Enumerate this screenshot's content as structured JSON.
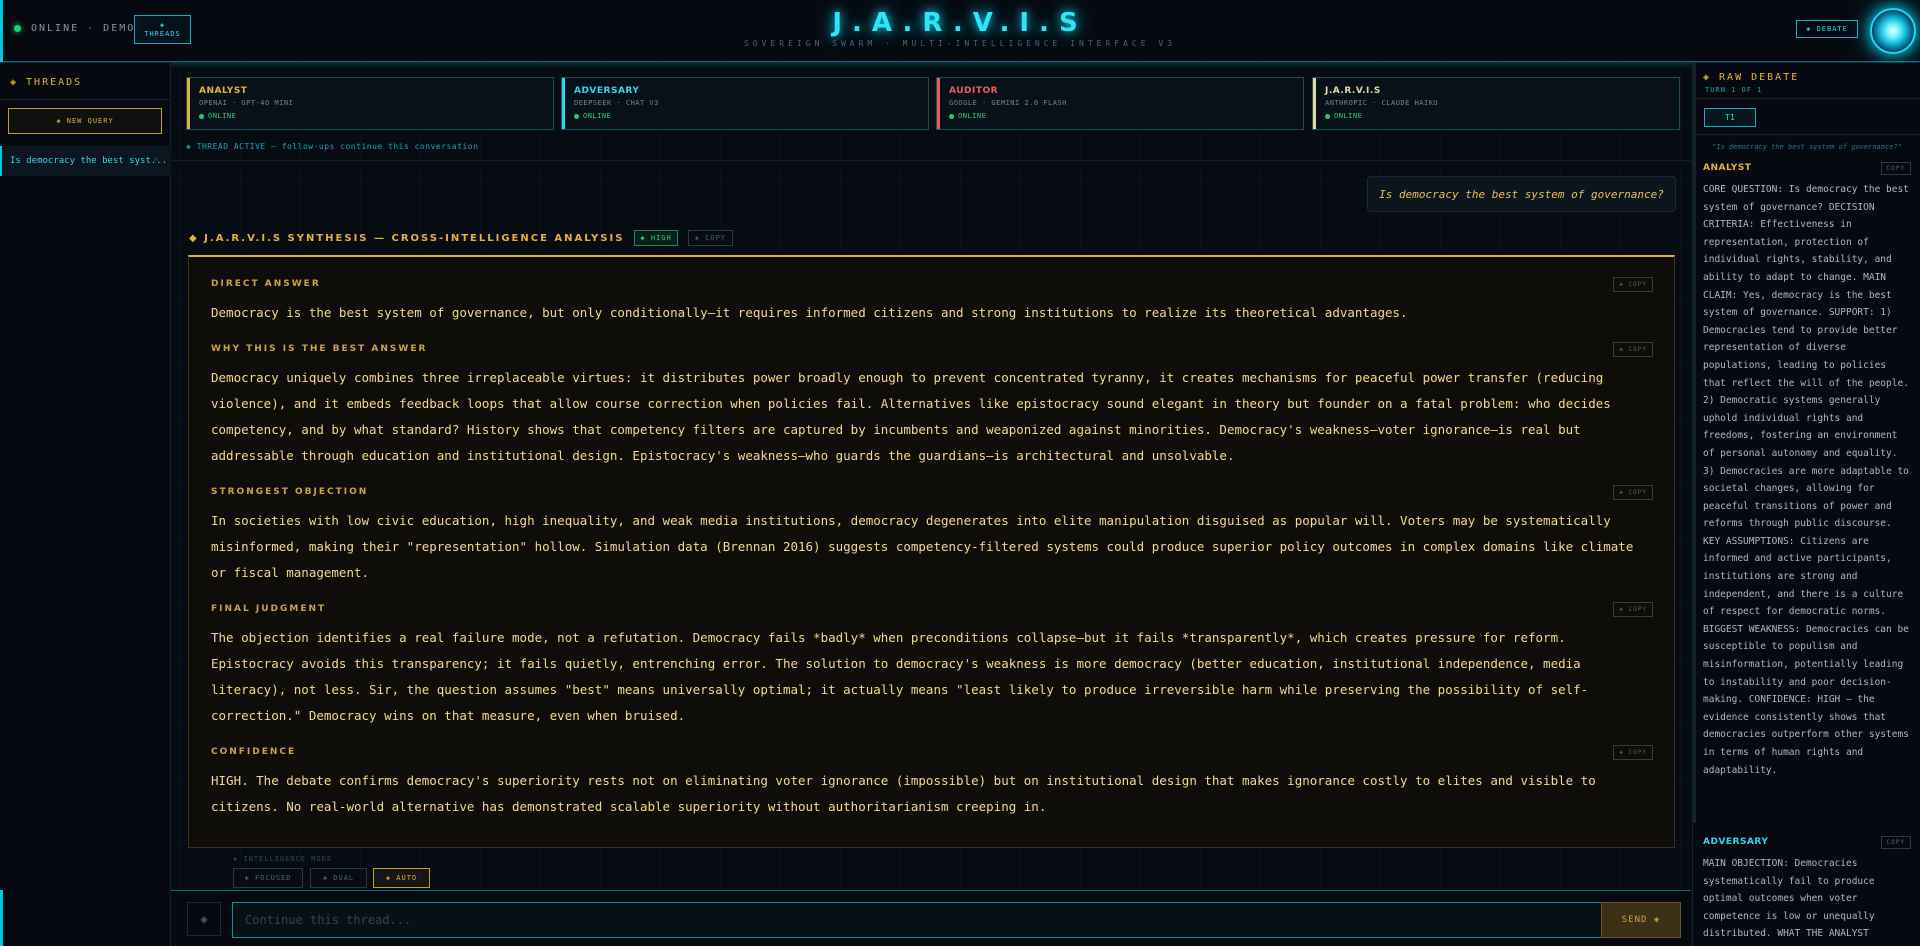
{
  "header": {
    "status_text": "ONLINE · DEMO",
    "threads_icon": "◈",
    "threads_label": "THREADS",
    "title": "J.A.R.V.I.S",
    "subtitle": "SOVEREIGN SWARM · MULTI-INTELLIGENCE INTERFACE V3",
    "debate_label": "◈ DEBATE"
  },
  "sidebar": {
    "title": "◈ THREADS",
    "new_query_label": "◈ NEW QUERY",
    "threads": [
      {
        "label": "Is democracy the best syst...",
        "close": "×"
      }
    ]
  },
  "agents": [
    {
      "name": "ANALYST",
      "model": "OPENAI · GPT-4O MINI",
      "status": "ONLINE",
      "color": "#e2b23a"
    },
    {
      "name": "ADVERSARY",
      "model": "DEEPSEEK · CHAT V3",
      "status": "ONLINE",
      "color": "#2fd6ec"
    },
    {
      "name": "AUDITOR",
      "model": "GOOGLE · GEMINI 2.0 FLASH",
      "status": "ONLINE",
      "color": "#ee5a5a"
    },
    {
      "name": "J.A.R.V.I.S",
      "model": "ANTHROPIC · CLAUDE HAIKU",
      "status": "ONLINE",
      "color": "#e8d7a0"
    }
  ],
  "thread_active": "◈ THREAD ACTIVE — follow-ups continue this conversation",
  "query": "Is democracy the best system of governance?",
  "synthesis": {
    "title": "◆ J.A.R.V.I.S SYNTHESIS — CROSS-INTELLIGENCE ANALYSIS",
    "confidence_badge": "◆ HIGH",
    "copy_label": "◈ COPY",
    "sections": [
      {
        "label": "DIRECT ANSWER",
        "copy": "◈ COPY",
        "text": "Democracy is the best system of governance, but only conditionally—it requires informed citizens and strong institutions to realize its theoretical advantages."
      },
      {
        "label": "WHY THIS IS THE BEST ANSWER",
        "copy": "◈ COPY",
        "text": "Democracy uniquely combines three irreplaceable virtues: it distributes power broadly enough to prevent concentrated tyranny, it creates mechanisms for peaceful power transfer (reducing violence), and it embeds feedback loops that allow course correction when policies fail. Alternatives like epistocracy sound elegant in theory but founder on a fatal problem: who decides competency, and by what standard? History shows that competency filters are captured by incumbents and weaponized against minorities. Democracy's weakness—voter ignorance—is real but addressable through education and institutional design. Epistocracy's weakness—who guards the guardians—is architectural and unsolvable."
      },
      {
        "label": "STRONGEST OBJECTION",
        "copy": "◈ COPY",
        "text": "In societies with low civic education, high inequality, and weak media institutions, democracy degenerates into elite manipulation disguised as popular will. Voters may be systematically misinformed, making their \"representation\" hollow. Simulation data (Brennan 2016) suggests competency-filtered systems could produce superior policy outcomes in complex domains like climate or fiscal management."
      },
      {
        "label": "FINAL JUDGMENT",
        "copy": "◈ COPY",
        "text": "The objection identifies a real failure mode, not a refutation. Democracy fails *badly* when preconditions collapse—but it fails *transparently*, which creates pressure for reform. Epistocracy avoids this transparency; it fails quietly, entrenching error. The solution to democracy's weakness is more democracy (better education, institutional independence, media literacy), not less. Sir, the question assumes \"best\" means universally optimal; it actually means \"least likely to produce irreversible harm while preserving the possibility of self-correction.\" Democracy wins on that measure, even when bruised."
      },
      {
        "label": "CONFIDENCE",
        "copy": "◈ COPY",
        "text": "HIGH. The debate confirms democracy's superiority rests not on eliminating voter ignorance (impossible) but on institutional design that makes ignorance costly to elites and visible to citizens. No real-world alternative has demonstrated scalable superiority without authoritarianism creeping in."
      }
    ]
  },
  "modes": {
    "label": "◈ INTELLIGENCE MODE",
    "options": [
      {
        "label": "◈ FOCUSED",
        "active": false
      },
      {
        "label": "◈ DUAL",
        "active": false
      },
      {
        "label": "◈ AUTO",
        "active": true
      }
    ]
  },
  "input": {
    "attach_icon": "◈",
    "placeholder": "Continue this thread...",
    "value": "",
    "send_label": "SEND ◈"
  },
  "debate_panel": {
    "title": "◈ RAW DEBATE",
    "turn": "TURN 1 OF 1",
    "tab": "T1",
    "question": "\"Is democracy the best system of governance?\"",
    "entries": [
      {
        "agent": "ANALYST",
        "color": "#e2b23a",
        "copy": "COPY",
        "text": "CORE QUESTION: Is democracy the best system of governance? DECISION CRITERIA: Effectiveness in representation, protection of individual rights, stability, and ability to adapt to change. MAIN CLAIM: Yes, democracy is the best system of governance. SUPPORT: 1) Democracies tend to provide better representation of diverse populations, leading to policies that reflect the will of the people. 2) Democratic systems generally uphold individual rights and freedoms, fostering an environment of personal autonomy and equality. 3) Democracies are more adaptable to societal changes, allowing for peaceful transitions of power and reforms through public discourse. KEY ASSUMPTIONS: Citizens are informed and active participants, institutions are strong and independent, and there is a culture of respect for democratic norms. BIGGEST WEAKNESS: Democracies can be susceptible to populism and misinformation, potentially leading to instability and poor decision-making. CONFIDENCE: HIGH — the evidence consistently shows that democracies outperform other systems in terms of human rights and adaptability."
      },
      {
        "agent": "ADVERSARY",
        "color": "#2fd6ec",
        "copy": "COPY",
        "text": "MAIN OBJECTION: Democracies systematically fail to produce optimal outcomes when voter competence is low or unequally distributed. WHAT THE ANALYST MISSED: The analyst treats democracy as"
      }
    ]
  }
}
